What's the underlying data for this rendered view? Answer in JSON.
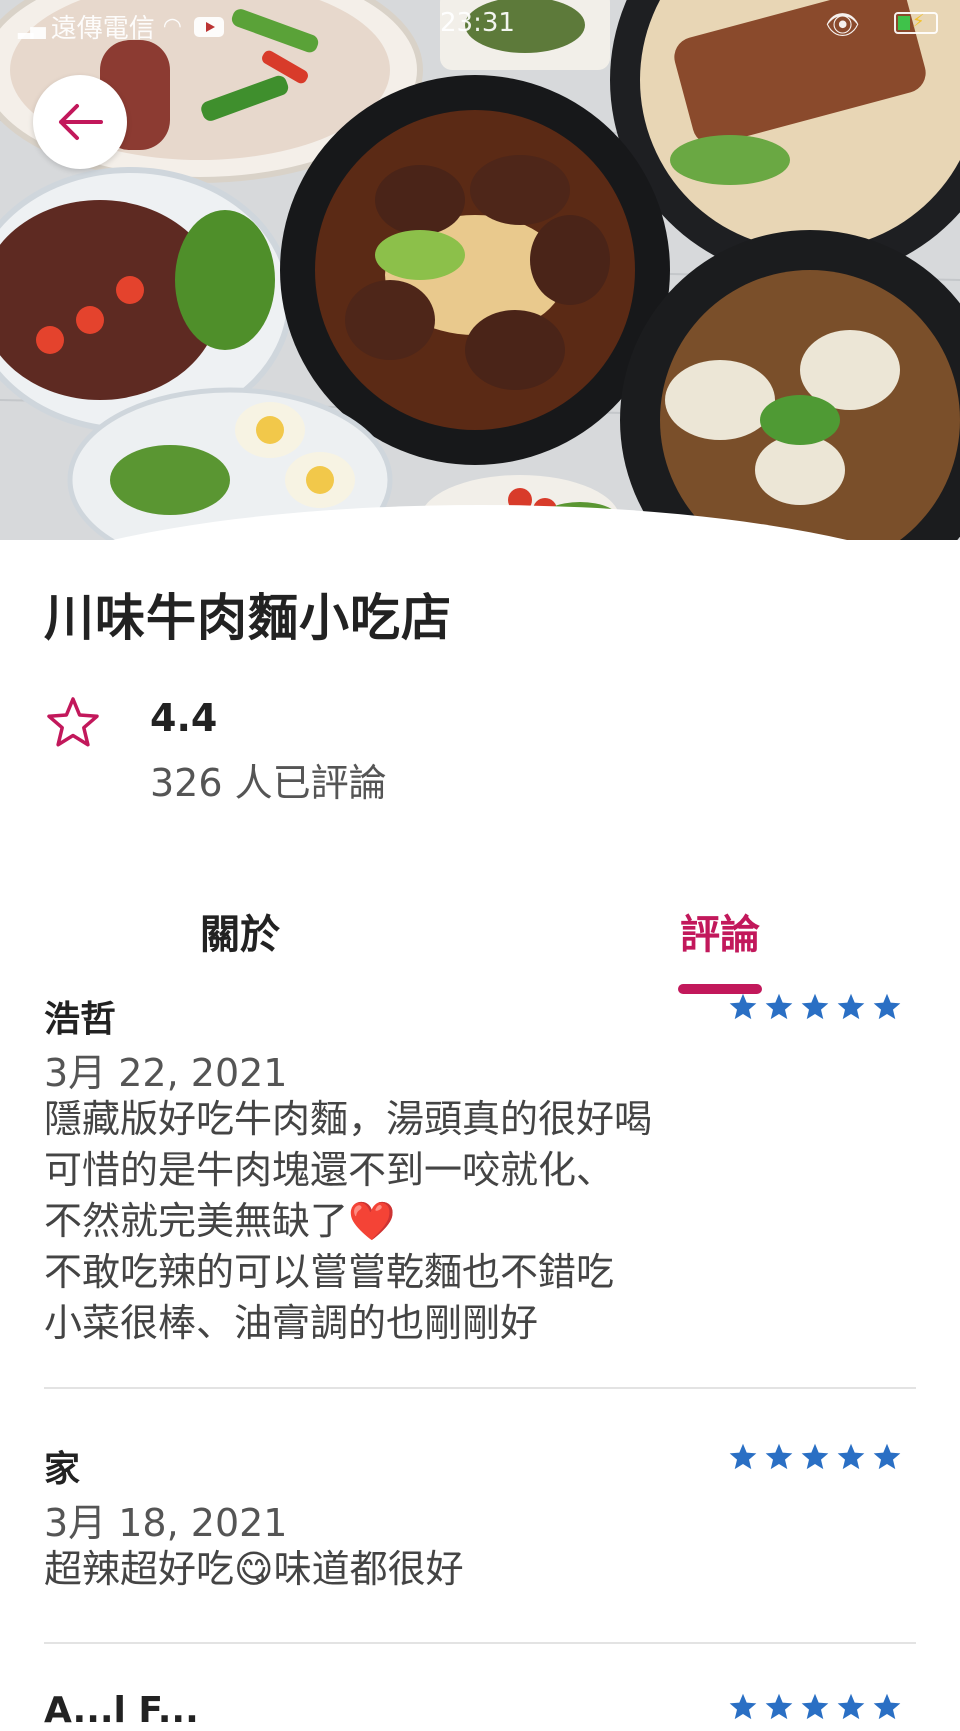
{
  "status_bar": {
    "carrier": "遠傳電信",
    "time": "23:31",
    "colors": {
      "battery": "#3fc24a"
    }
  },
  "restaurant": {
    "name": "川味牛肉麵小吃店",
    "rating": "4.4",
    "review_count": "326 人已評論"
  },
  "tabs": [
    {
      "label": "關於",
      "selected": false
    },
    {
      "label": "評論",
      "selected": true
    }
  ],
  "reviews": [
    {
      "author": "浩哲",
      "date": "3月 22, 2021",
      "stars": 5,
      "text": "隱藏版好吃牛肉麵，湯頭真的很好喝\n可惜的是牛肉塊還不到一咬就化、\n不然就完美無缺了❤️\n不敢吃辣的可以嘗嘗乾麵也不錯吃\n小菜很棒、油膏調的也剛剛好"
    },
    {
      "author": "家",
      "date": "3月 18, 2021",
      "stars": 5,
      "text": "超辣超好吃😋味道都很好"
    },
    {
      "author": "A...l F...",
      "stars": 5
    }
  ],
  "colors": {
    "accent": "#c2185b",
    "star": "#2a6fc4",
    "text": "#222222",
    "secondary_text": "#555555"
  },
  "icons": {
    "back": "arrow-left-icon",
    "rating": "star-outline-icon",
    "review_star": "star-filled-icon"
  }
}
